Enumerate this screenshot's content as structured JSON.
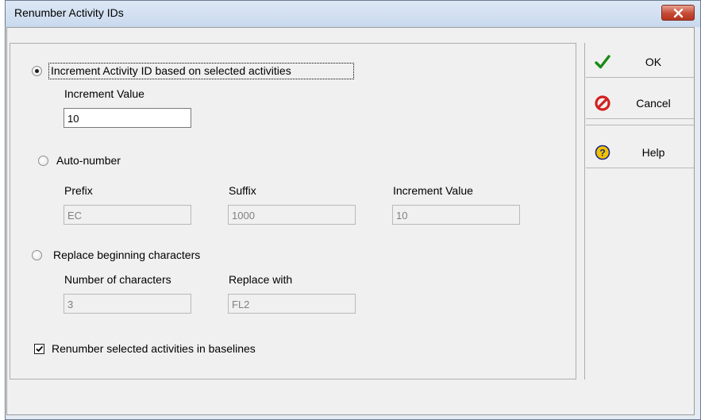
{
  "window": {
    "title": "Renumber Activity IDs"
  },
  "options": {
    "increment": {
      "label": "Increment Activity ID based on selected activities",
      "selected": true,
      "value_label": "Increment Value",
      "value": "10"
    },
    "auto_number": {
      "label": "Auto-number",
      "selected": false,
      "prefix_label": "Prefix",
      "prefix_value": "EC",
      "suffix_label": "Suffix",
      "suffix_value": "1000",
      "increment_label": "Increment Value",
      "increment_value": "10"
    },
    "replace": {
      "label": "Replace beginning characters",
      "selected": false,
      "count_label": "Number of characters",
      "count_value": "3",
      "replace_label": "Replace with",
      "replace_value": "FL2"
    },
    "baselines": {
      "label": "Renumber selected activities in baselines",
      "checked": true
    }
  },
  "buttons": {
    "ok": "OK",
    "cancel": "Cancel",
    "help": "Help"
  },
  "icons": {
    "close": "close-icon",
    "ok": "checkmark-icon",
    "cancel": "no-entry-icon",
    "help": "question-mark-icon"
  },
  "colors": {
    "close_button": "#c44a34",
    "ok_check": "#1a8a16",
    "cancel_icon": "#d32020",
    "help_icon": "#f2c200"
  }
}
